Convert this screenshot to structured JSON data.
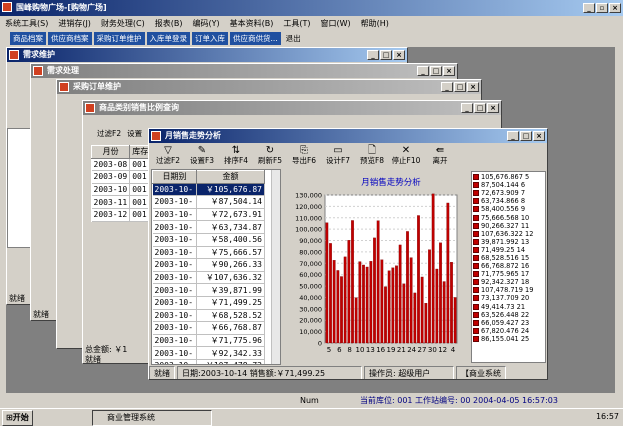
{
  "app": {
    "title": "国峰购物广场-[购物广场]",
    "menu": [
      "系统工具(S)",
      "进销存(J)",
      "财务处理(C)",
      "报表(B)",
      "编码(Y)",
      "基本资料(B)",
      "工具(T)",
      "窗口(W)",
      "帮助(H)"
    ],
    "quick": [
      "商品档案",
      "供应商档案",
      "采购订单维护",
      "入库单登录",
      "订单入库",
      "供应商供货...",
      "退出"
    ]
  },
  "windows": {
    "w1": "需求维护",
    "w2": "需求处理",
    "w3": "采购订单维护",
    "w4": "商品类别销售比例查询",
    "main": "月销售走势分析"
  },
  "toolbar": [
    {
      "icon": "▽",
      "label": "过滤F2"
    },
    {
      "icon": "✎",
      "label": "设置F3"
    },
    {
      "icon": "⇅",
      "label": "排序F4"
    },
    {
      "icon": "↻",
      "label": "刷新F5"
    },
    {
      "icon": "⎘",
      "label": "导出F6"
    },
    {
      "icon": "▭",
      "label": "设计F7"
    },
    {
      "icon": "🗋",
      "label": "预览F8"
    },
    {
      "icon": "✕",
      "label": "停止F10"
    },
    {
      "icon": "⇚",
      "label": "离开"
    }
  ],
  "w4toolbar": [
    "过滤F2",
    "设置"
  ],
  "w4grid": {
    "headers": [
      "月份",
      "库存"
    ],
    "rows": [
      [
        "2003-08",
        "001"
      ],
      [
        "2003-09",
        "001"
      ],
      [
        "2003-10",
        "001"
      ],
      [
        "2003-11",
        "001"
      ],
      [
        "2003-12",
        "001"
      ]
    ]
  },
  "table": {
    "headers": [
      "日期别",
      "金额"
    ],
    "rows": [
      [
        "2003-10-",
        "￥105,676.87"
      ],
      [
        "2003-10-",
        "￥87,504.14"
      ],
      [
        "2003-10-",
        "￥72,673.91"
      ],
      [
        "2003-10-",
        "￥63,734.87"
      ],
      [
        "2003-10-",
        "￥58,400.56"
      ],
      [
        "2003-10-",
        "￥75,666.57"
      ],
      [
        "2003-10-",
        "￥90,266.33"
      ],
      [
        "2003-10-",
        "￥107,636.32"
      ],
      [
        "2003-10-",
        "￥39,871.99"
      ],
      [
        "2003-10-",
        "￥71,499.25"
      ],
      [
        "2003-10-",
        "￥68,528.52"
      ],
      [
        "2003-10-",
        "￥66,768.87"
      ],
      [
        "2003-10-",
        "￥71,775.96"
      ],
      [
        "2003-10-",
        "￥92,342.33"
      ],
      [
        "2003-10-",
        "￥107,478.72"
      ],
      [
        "2003-10-",
        "￥73,137.71"
      ],
      [
        "2003-10-",
        "￥49,414.73"
      ]
    ]
  },
  "chart_data": {
    "type": "bar",
    "title": "月销售走势分析",
    "xticks": [
      "5",
      "6",
      "8",
      "10",
      "13",
      "16",
      "19",
      "21",
      "24",
      "27",
      "30",
      "12",
      "4"
    ],
    "yticks": [
      "0",
      "10,000",
      "20,000",
      "30,000",
      "40,000",
      "50,000",
      "60,000",
      "70,000",
      "80,000",
      "90,000",
      "100,000",
      "110,000",
      "120,000",
      "130,000"
    ],
    "ylim": [
      0,
      130000
    ],
    "values": [
      105677,
      87504,
      72674,
      63735,
      58401,
      75667,
      90266,
      107636,
      39872,
      71499,
      68529,
      66769,
      71776,
      92342,
      107479,
      73137,
      49415,
      63526,
      66059,
      67820,
      86155,
      52000,
      98000,
      75000,
      44000,
      112000,
      58000,
      35000,
      82000,
      131000,
      65000,
      88000,
      54000,
      123000,
      71000,
      40000
    ],
    "legend": [
      "105,676.867 5",
      "87,504.144 6",
      "72,673.909 7",
      "63,734.866 8",
      "58,400.556 9",
      "75,666.568 10",
      "90,266.327 11",
      "107,636.322 12",
      "39,871.992 13",
      "71,499.25 14",
      "68,528.516 15",
      "66,768.872 16",
      "71,775.965 17",
      "92,342.327 18",
      "107,478.719 19",
      "73,137.709 20",
      "49,414.73 21",
      "63,526.448 22",
      "66,059.427 23",
      "67,820.476 24",
      "86,155.041 25"
    ]
  },
  "status": {
    "ready": "就绪",
    "date": "日期:2003-10-14 销售额:￥71,499.25",
    "operator": "操作员: 超级用户",
    "system": "【商业系统"
  },
  "bottom": {
    "num": "Num",
    "store": "当前库位: 001 工作站编号: 00 2004-04-05 16:57:03"
  },
  "w2status": "就绪",
  "w2left": "就绪",
  "total": "总金额: ￥1",
  "taskbar": {
    "start": "开始",
    "app": "商业管理系统",
    "time": "16:57"
  }
}
